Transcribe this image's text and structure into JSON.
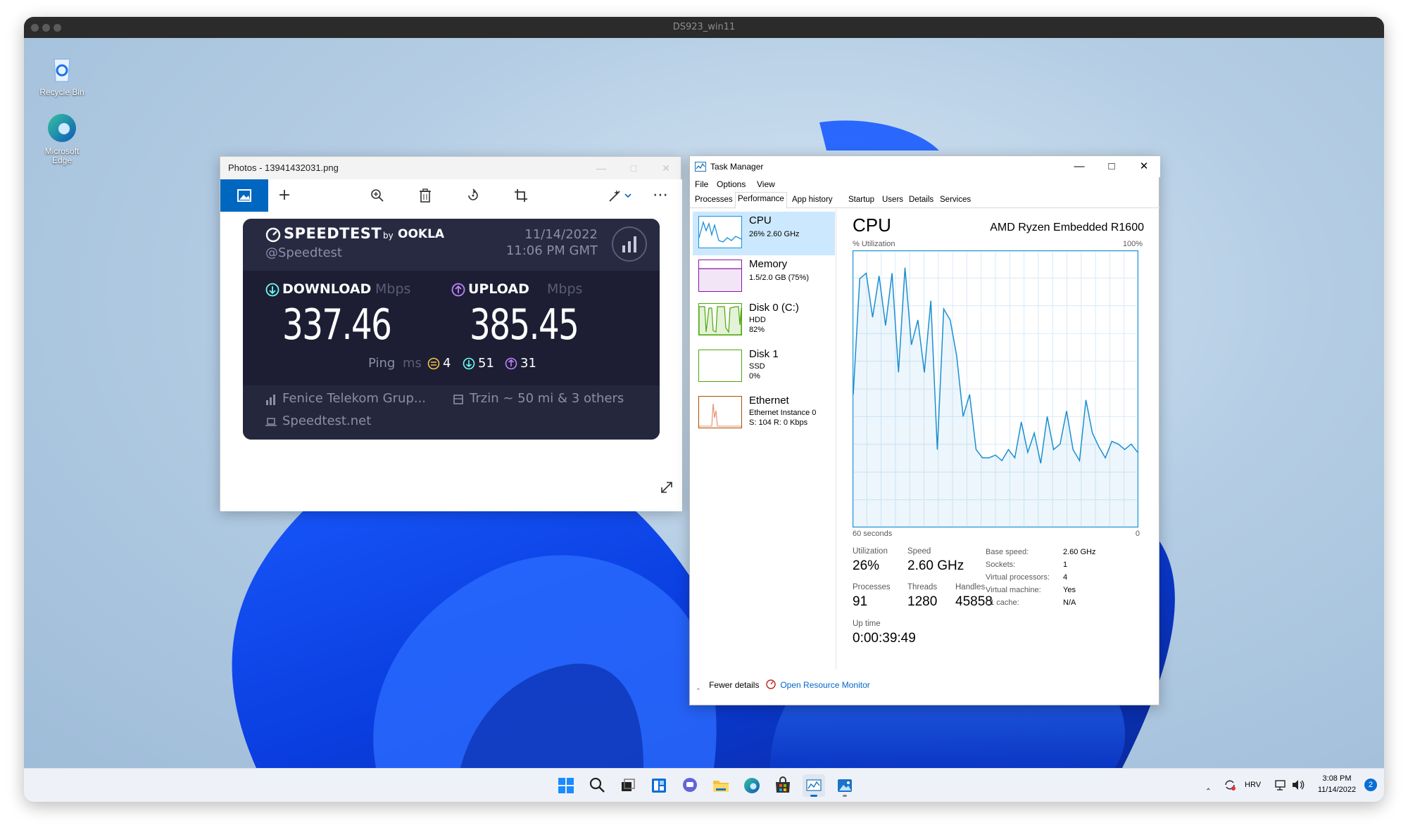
{
  "vm": {
    "title": "DS923_win11"
  },
  "desktop": {
    "icons": [
      {
        "label": "Recycle Bin",
        "icon": "recycle-bin-icon"
      },
      {
        "label": "Microsoft Edge",
        "icon": "edge-icon"
      }
    ]
  },
  "photos": {
    "title": "Photos - 13941432031.png",
    "toolbar": [
      "image-icon",
      "add-icon",
      "zoom-in-icon",
      "delete-icon",
      "rotate-icon",
      "crop-icon",
      "edit-icon",
      "more-icon"
    ],
    "speedtest": {
      "brand": "SPEEDTEST",
      "by": "by",
      "ookla": "OOKLA",
      "handle": "@Speedtest",
      "date": "11/14/2022",
      "time": "11:06 PM GMT",
      "download_label": "DOWNLOAD",
      "upload_label": "UPLOAD",
      "unit": "Mbps",
      "download_value": "337.46",
      "upload_value": "385.45",
      "ping_label": "Ping",
      "ping_unit": "ms",
      "ping_idle": "4",
      "ping_down": "51",
      "ping_up": "31",
      "isp": "Fenice Telekom Grup...",
      "server": "Trzin ~ 50 mi & 3 others",
      "site": "Speedtest.net"
    }
  },
  "taskmgr": {
    "title": "Task Manager",
    "menu": [
      "File",
      "Options",
      "View"
    ],
    "tabs": [
      "Processes",
      "Performance",
      "App history",
      "Startup",
      "Users",
      "Details",
      "Services"
    ],
    "resources": [
      {
        "name": "CPU",
        "sub1": "26%  2.60 GHz",
        "sub2": ""
      },
      {
        "name": "Memory",
        "sub1": "1.5/2.0 GB (75%)",
        "sub2": ""
      },
      {
        "name": "Disk 0 (C:)",
        "sub1": "HDD",
        "sub2": "82%"
      },
      {
        "name": "Disk 1",
        "sub1": "SSD",
        "sub2": "0%"
      },
      {
        "name": "Ethernet",
        "sub1": "Ethernet Instance 0",
        "sub2": "S: 104  R: 0 Kbps"
      }
    ],
    "cpu": {
      "heading": "CPU",
      "model": "AMD Ryzen Embedded R1600",
      "util_axis_label": "% Utilization",
      "max_label": "100%",
      "time_label": "60 seconds",
      "min_label": "0",
      "history": [
        48,
        90,
        92,
        76,
        91,
        73,
        92,
        56,
        94,
        66,
        75,
        56,
        82,
        28,
        79,
        75,
        62,
        40,
        48,
        28,
        25,
        25,
        26,
        24,
        28,
        25,
        38,
        27,
        34,
        23,
        40,
        28,
        30,
        42,
        28,
        24,
        46,
        34,
        29,
        25,
        31,
        30,
        28,
        30,
        27
      ],
      "utilization_label": "Utilization",
      "utilization": "26%",
      "speed_label": "Speed",
      "speed": "2.60 GHz",
      "processes_label": "Processes",
      "processes": "91",
      "threads_label": "Threads",
      "threads": "1280",
      "handles_label": "Handles",
      "handles": "45858",
      "uptime_label": "Up time",
      "uptime": "0:00:39:49",
      "specs": [
        {
          "k": "Base speed:",
          "v": "2.60 GHz"
        },
        {
          "k": "Sockets:",
          "v": "1"
        },
        {
          "k": "Virtual processors:",
          "v": "4"
        },
        {
          "k": "Virtual machine:",
          "v": "Yes"
        },
        {
          "k": "L1 cache:",
          "v": "N/A"
        }
      ]
    },
    "footer": {
      "fewer": "Fewer details",
      "monitor": "Open Resource Monitor"
    }
  },
  "taskbar": {
    "apps": [
      "start-icon",
      "search-icon",
      "task-view-icon",
      "widgets-icon",
      "teams-chat-icon",
      "file-explorer-icon",
      "edge-icon",
      "store-icon",
      "task-manager-icon",
      "photos-icon"
    ],
    "lang": "HRV",
    "time": "3:08 PM",
    "date": "11/14/2022",
    "notifications": "2"
  },
  "colors": {
    "accent": "#0067c0",
    "speed_down": "#6afff3",
    "speed_up": "#c082ff",
    "graph_line": "#1a8fd0"
  }
}
